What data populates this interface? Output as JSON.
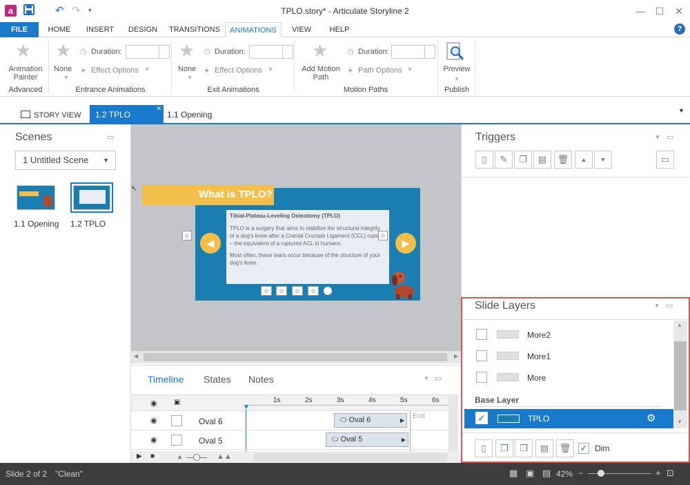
{
  "window": {
    "title": "TPLO.story* - Articulate Storyline 2",
    "app_icon_letter": "a",
    "minimize_glyph": "—",
    "maximize_glyph": "☐",
    "close_glyph": "✕"
  },
  "ribbon_tabs": [
    {
      "label": "FILE"
    },
    {
      "label": "HOME"
    },
    {
      "label": "INSERT"
    },
    {
      "label": "DESIGN"
    },
    {
      "label": "TRANSITIONS"
    },
    {
      "label": "ANIMATIONS"
    },
    {
      "label": "VIEW"
    },
    {
      "label": "HELP"
    }
  ],
  "ribbon": {
    "advanced": {
      "button_line1": "Animation",
      "button_line2": "Painter",
      "group_label": "Advanced"
    },
    "entrance": {
      "none_label": "None",
      "duration_label": "Duration:",
      "duration_value": "",
      "effect_options_label": "Effect Options",
      "group_label": "Entrance Animations"
    },
    "exit": {
      "none_label": "None",
      "duration_label": "Duration:",
      "duration_value": "",
      "effect_options_label": "Effect Options",
      "group_label": "Exit Animations"
    },
    "motion": {
      "add_line1": "Add Motion",
      "add_line2": "Path",
      "duration_label": "Duration:",
      "duration_value": "",
      "path_options_label": "Path Options",
      "group_label": "Motion Paths"
    },
    "publish": {
      "preview_label": "Preview",
      "group_label": "Publish"
    }
  },
  "view_tabs": {
    "story_view": "STORY VIEW",
    "active_tab": "1.2 TPLO",
    "other_tab": "1.1 Opening",
    "close_glyph": "✕"
  },
  "scenes": {
    "title": "Scenes",
    "dropdown_value": "1 Untitled Scene",
    "slides": [
      {
        "label": "1.1 Opening"
      },
      {
        "label": "1.2 TPLO"
      }
    ]
  },
  "slide": {
    "heading": "What is TPLO?",
    "card_title": "Tibial-Plateau-Leveling Osteotomy (TPLO)",
    "para1": "TPLO is a surgery that aims to stabilize the structural integrity of a dog's knee after a Cranial Cruciate Ligament (CCL) rupture – the equivalent of a ruptured ACL in humans.",
    "para2": "Most often, these tears occur because of the structure of your dog's knee."
  },
  "timeline": {
    "tabs": [
      {
        "label": "Timeline"
      },
      {
        "label": "States"
      },
      {
        "label": "Notes"
      }
    ],
    "ticks": [
      "1s",
      "2s",
      "3s",
      "4s",
      "5s",
      "6s"
    ],
    "end_label": "End",
    "rows": [
      {
        "name": "Oval 6",
        "bar_label": "Oval 6"
      },
      {
        "name": "Oval 5",
        "bar_label": "Oval 5"
      }
    ]
  },
  "triggers": {
    "title": "Triggers"
  },
  "layers": {
    "title": "Slide Layers",
    "items": [
      {
        "label": "More2"
      },
      {
        "label": "More1"
      },
      {
        "label": "More"
      }
    ],
    "base_header": "Base Layer",
    "base_item": "TPLO",
    "dim_label": "Dim"
  },
  "status": {
    "slide_info": "Slide 2 of 2",
    "theme": "\"Clean\"",
    "zoom": "42%"
  },
  "colors": {
    "accent": "#1979ca",
    "slide_blue": "#1a7fb0",
    "heading_yellow": "#f3bf4b",
    "selection_border": "#d9534f"
  }
}
